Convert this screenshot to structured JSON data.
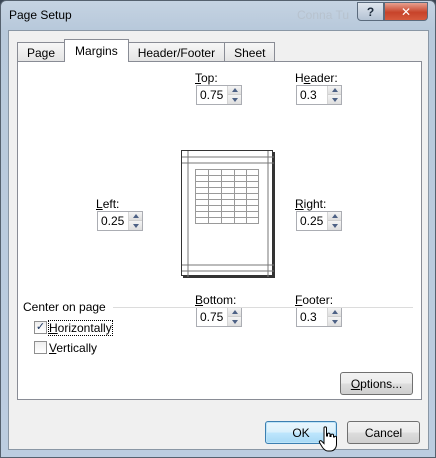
{
  "window": {
    "title": "Page Setup",
    "ghost_text": "Conna Tu",
    "help_label": "?",
    "close_label": "✕"
  },
  "tabs": [
    {
      "label": "Page",
      "active": false
    },
    {
      "label": "Margins",
      "active": true
    },
    {
      "label": "Header/Footer",
      "active": false
    },
    {
      "label": "Sheet",
      "active": false
    }
  ],
  "margins": {
    "top": {
      "accel": "T",
      "rest": "op:",
      "value": "0.75"
    },
    "header": {
      "pre": "H",
      "accel": "e",
      "rest": "ader:",
      "value": "0.3"
    },
    "left": {
      "accel": "L",
      "rest": "eft:",
      "value": "0.25"
    },
    "right": {
      "accel": "R",
      "rest": "ight:",
      "value": "0.25"
    },
    "bottom": {
      "accel": "B",
      "rest": "ottom:",
      "value": "0.75"
    },
    "footer": {
      "accel": "F",
      "rest": "ooter:",
      "value": "0.3"
    }
  },
  "center": {
    "title": "Center on page",
    "horizontally": {
      "accel": "H",
      "rest": "orizontally",
      "checked": true
    },
    "vertically": {
      "accel": "V",
      "rest": "ertically",
      "checked": false
    },
    "check_glyph": "✓"
  },
  "buttons": {
    "options": {
      "accel": "O",
      "rest": "ptions..."
    },
    "ok": "OK",
    "cancel": "Cancel"
  }
}
